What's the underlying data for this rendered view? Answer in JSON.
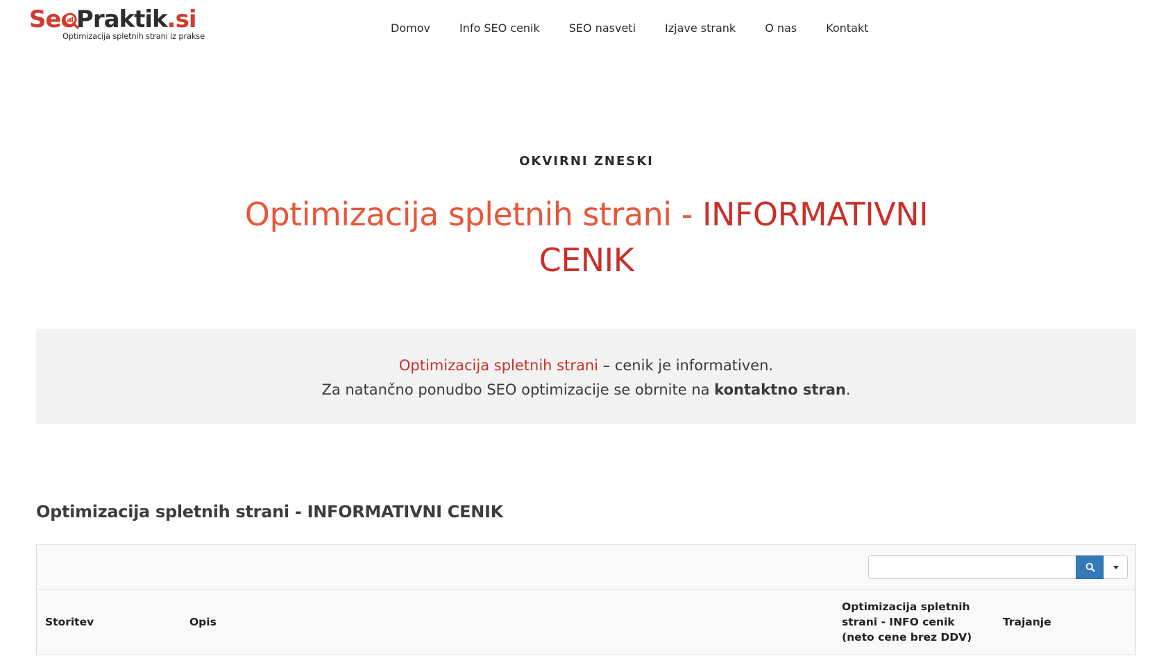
{
  "header": {
    "logo": {
      "seo": "Seo",
      "praktik": "Praktik",
      "tld": ".si",
      "tagline": "Optimizacija spletnih strani iz prakse"
    },
    "nav": [
      {
        "label": "Domov"
      },
      {
        "label": "Info SEO cenik"
      },
      {
        "label": "SEO nasveti"
      },
      {
        "label": "Izjave strank"
      },
      {
        "label": "O nas"
      },
      {
        "label": "Kontakt"
      }
    ]
  },
  "hero": {
    "eyebrow": "OKVIRNI ZNESKI",
    "title_line1_a": "Optimizacija spletnih strani - ",
    "title_line1_b": "INFORMATIVNI",
    "title_line2": "CENIK"
  },
  "info": {
    "link_text": "Optimizacija spletnih strani",
    "line1_rest": " – cenik je informativen.",
    "line2_start": "Za natančno ponudbo SEO optimizacije se obrnite na ",
    "line2_strong": "kontaktno stran",
    "line2_end": "."
  },
  "section": {
    "title": "Optimizacija spletnih strani - INFORMATIVNI CENIK"
  },
  "table": {
    "search": {
      "placeholder": "",
      "value": ""
    },
    "headers": {
      "storitev": "Storitev",
      "opis": "Opis",
      "cena": "Optimizacija spletnih strani - INFO cenik (neto cene brez DDV)",
      "trajanje": "Trajanje"
    }
  },
  "colors": {
    "accent_red": "#c9302a",
    "accent_orange": "#e8563a",
    "search_button": "#337ab7",
    "info_bg": "#f2f2f2"
  },
  "icons": {
    "search": "search-icon",
    "dropdown": "caret-down-icon",
    "logo_magnifier": "magnifier-icon"
  }
}
